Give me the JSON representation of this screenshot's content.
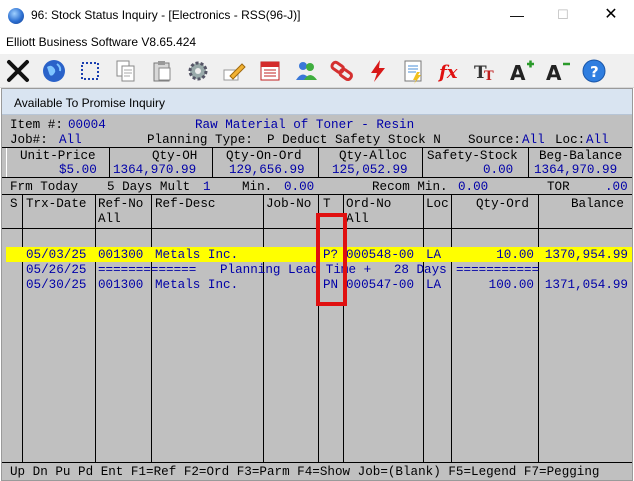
{
  "window": {
    "title": "96: Stock Status Inquiry - [Electronics - RSS(96-J)]",
    "minimize": "—",
    "maximize": "☐",
    "close": "✕"
  },
  "brand": "Elliott Business Software V8.65.424",
  "toolbar": {
    "icons": [
      "exit-icon",
      "globe-icon",
      "select-icon",
      "copy-icon",
      "paste-icon",
      "settings-icon",
      "edit-icon",
      "calendar-icon",
      "users-icon",
      "link-icon",
      "flash-icon",
      "report-icon",
      "function-icon",
      "font-icon",
      "font-larger-icon",
      "font-smaller-icon",
      "help-icon"
    ]
  },
  "inner_window": {
    "title": "Available To Promise Inquiry"
  },
  "header": {
    "item_label": "Item #:",
    "item_no": "00004",
    "item_desc": "Raw Material of Toner - Resin",
    "job_label": "Job#:",
    "job_value": "All",
    "planning_label": "Planning Type:",
    "planning_value": "P Deduct Safety Stock N",
    "source_label": "Source:",
    "source_value": "All",
    "loc_label": "Loc:",
    "loc_value": "All"
  },
  "summary": {
    "headers": [
      "Unit-Price",
      "Qty-OH",
      "Qty-On-Ord",
      "Qty-Alloc",
      "Safety-Stock",
      "Beg-Balance"
    ],
    "values": [
      "$5.00",
      "1364,970.99",
      "129,656.99",
      "125,052.99",
      "0.00",
      "1364,970.99"
    ]
  },
  "params": {
    "frm_label": "Frm Today",
    "days_label": "5 Days Mult",
    "mult_value": "1",
    "min_label": "Min.",
    "min_value": "0.00",
    "recom_label": "Recom Min.",
    "recom_value": "0.00",
    "tor_label": "TOR",
    "tor_value": ".00"
  },
  "grid": {
    "headers": {
      "s": "S",
      "trx_date": "Trx-Date",
      "ref_no": "Ref-No",
      "ref_no_sub": "All",
      "ref_desc": "Ref-Desc",
      "job_no": "Job-No",
      "t": "T",
      "ord_no": "Ord-No",
      "ord_no_sub": "All",
      "loc": "Loc",
      "qty_ord": "Qty-Ord",
      "balance": "Balance"
    },
    "rows": [
      {
        "trx_date": "05/03/25",
        "ref_no": "001300",
        "ref_desc": "Metals Inc.",
        "t": "P?",
        "ord_no": "000548-00",
        "loc": "LA",
        "qty_ord": "10.00",
        "balance": "1370,954.99"
      },
      {
        "trx_date": "05/26/25",
        "ref_no": "=============",
        "ref_desc": "Planning Lead Time +   28 Days",
        "filler": "==========="
      },
      {
        "trx_date": "05/30/25",
        "ref_no": "001300",
        "ref_desc": "Metals Inc.",
        "t": "PN",
        "ord_no": "000547-00",
        "loc": "LA",
        "qty_ord": "100.00",
        "balance": "1371,054.99"
      }
    ]
  },
  "status_bar": "Up Dn Pu Pd Ent F1=Ref F2=Ord F3=Parm F4=Show Job=(Blank) F5=Legend F7=Pegging"
}
